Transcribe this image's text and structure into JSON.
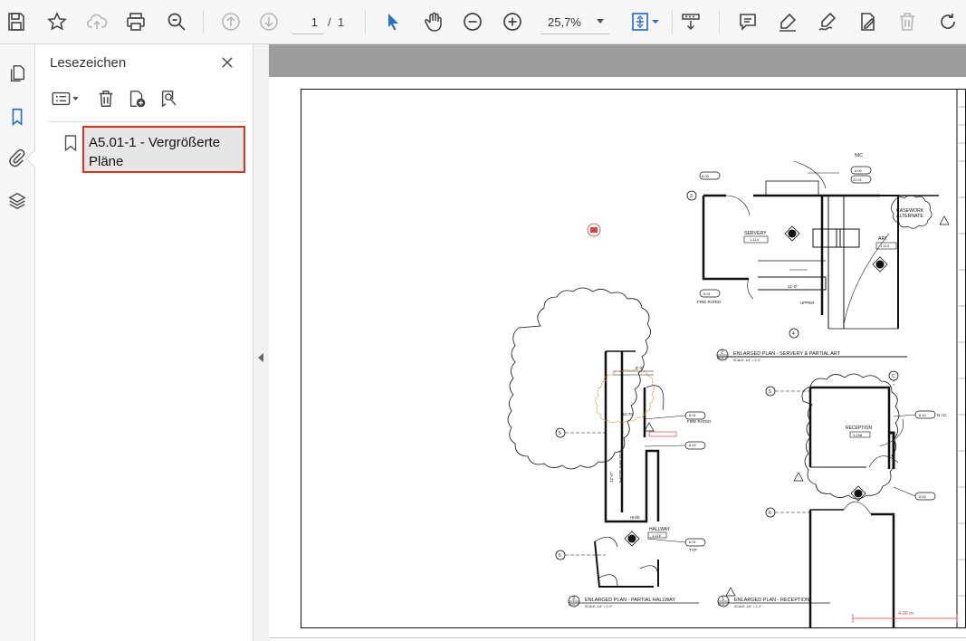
{
  "toolbar": {
    "page_current": "1",
    "page_separator": "/",
    "page_total": "1",
    "zoom": "25,7%",
    "accent_color": "#2a6fc9"
  },
  "sidebar": {
    "rail": [
      "pages-icon",
      "bookmark-icon",
      "paperclip-icon",
      "layers-icon"
    ]
  },
  "bookmarks": {
    "title": "Lesezeichen",
    "items": [
      {
        "label_line1": "A5.01-1 - Vergrößerte",
        "label_line2": "Pläne"
      }
    ],
    "highlight_color": "#e0321e"
  },
  "drawing": {
    "labels": {
      "nic": "NIC",
      "casework": "CASEWORK",
      "alternate": "ALTERNATE",
      "servery": "SERVERY",
      "servery_num": "1-114",
      "art": "ART",
      "art_num": "1-113",
      "fire_rated_a": "FIRE RATED",
      "upper": "UPPER",
      "fire_rated_b": "FIRE RATED",
      "slope": "1:12 MAX SLOPE",
      "hallway": "HALLWAY",
      "hallway_num": "1-116",
      "typ": "TYP",
      "reception": "RECEPTION",
      "reception_num": "1-106",
      "nic_b": "N.I.C.",
      "dim_11": "11'-0\"",
      "dim_12": "12'-0\"",
      "dim_8": "8'-3\"",
      "elev_1": "+10.70",
      "elev_2": "+9.80",
      "scale_label": "4.00 m"
    },
    "grid": {
      "g3": "3",
      "g4": "4",
      "g5a": "5",
      "g6a": "6",
      "g5b": "5",
      "g6b": "6",
      "gc": "C"
    },
    "tags": {
      "t1": "6.03",
      "t2": "6.09",
      "t3": "22.01",
      "t4": "6.01",
      "t5": "6.01",
      "t6": "6.02",
      "t7": "6.01",
      "t8": "6.10",
      "t9": "6.02"
    },
    "titles": [
      {
        "num": "2",
        "sheet": "A5.01-1",
        "title": "ENLARGED PLAN - SERVERY & PARTIAL ART",
        "scale": "SCALE: 1/4\" = 1'-0\""
      },
      {
        "num": "3",
        "sheet": "A5.01-1",
        "title": "ENLARGED PLAN - PARTIAL HALLWAY",
        "scale": "SCALE: 1/4\" = 1'-0\""
      },
      {
        "num": "1",
        "sheet": "A5.01-1",
        "title": "ENLARGED PLAN - RECEPTION",
        "scale": "SCALE: 1/4\" = 1'-0\""
      }
    ]
  }
}
